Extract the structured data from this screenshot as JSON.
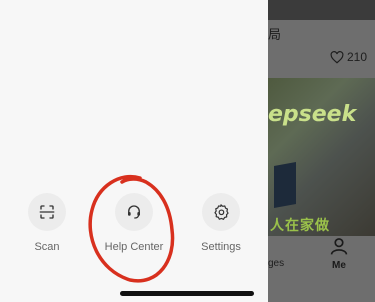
{
  "drawer": {
    "actions": [
      {
        "id": "scan",
        "label": "Scan",
        "icon": "scan-icon"
      },
      {
        "id": "help",
        "label": "Help Center",
        "icon": "headset-icon"
      },
      {
        "id": "settings",
        "label": "Settings",
        "icon": "gear-icon"
      }
    ]
  },
  "background": {
    "post_title_partial": "局",
    "likes": "210",
    "thumbnail_text": "epseek",
    "thumbnail_caption": "人在家做",
    "nav_partial_label": "ges",
    "nav_me_label": "Me"
  },
  "annotation": {
    "color": "#d8301e",
    "shape": "hand-drawn-circle"
  }
}
